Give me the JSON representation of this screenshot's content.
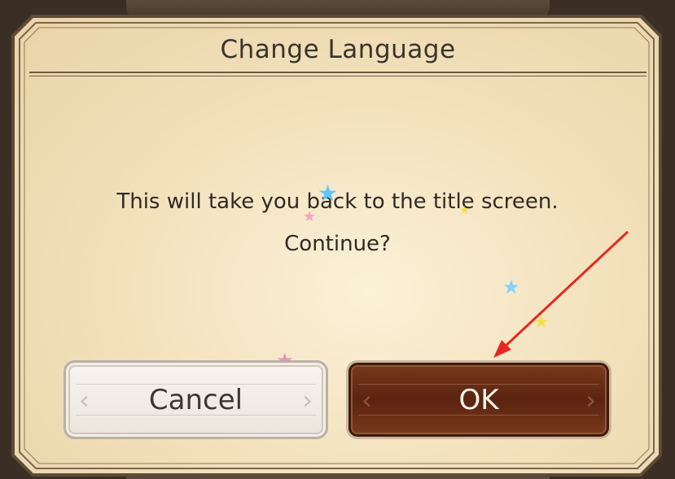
{
  "dialog": {
    "title": "Change Language",
    "message_line1": "This will take you back to the title screen.",
    "message_line2": "Continue?",
    "colors": {
      "parchment": "#f3e2bd",
      "frame": "#6e5a44",
      "ok_button": "#5b2410",
      "cancel_button": "#ebe5dd"
    }
  },
  "buttons": {
    "cancel_label": "Cancel",
    "ok_label": "OK"
  },
  "decorations": {
    "stars": [
      "blue-star-icon",
      "pink-star-icon",
      "yellow-star-icon"
    ],
    "annotation": "red-arrow-pointing-to-ok-button"
  }
}
